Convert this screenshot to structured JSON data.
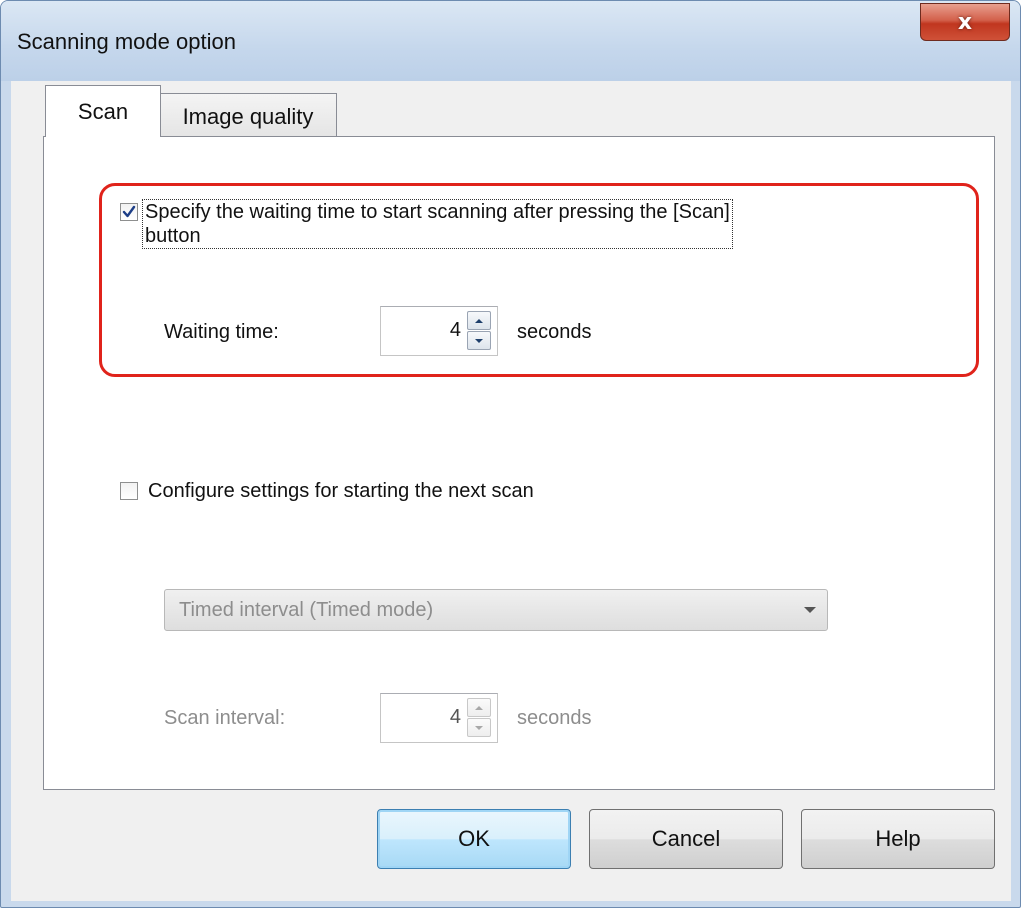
{
  "window": {
    "title": "Scanning mode option",
    "close_label": "x"
  },
  "tabs": [
    {
      "label": "Scan",
      "active": true
    },
    {
      "label": "Image quality",
      "active": false
    }
  ],
  "waiting": {
    "checkbox_checked": true,
    "checkbox_label_line1": "Specify the waiting time to start scanning after pressing the [Scan]",
    "checkbox_label_line2": "button",
    "time_label": "Waiting time:",
    "time_value": "4",
    "unit": "seconds",
    "highlight_color": "#e0231b"
  },
  "next_scan": {
    "checkbox_checked": false,
    "checkbox_label": "Configure settings for starting the next scan",
    "mode_selected": "Timed interval (Timed mode)",
    "interval_label": "Scan interval:",
    "interval_value": "4",
    "unit": "seconds",
    "disabled": true
  },
  "buttons": {
    "ok": "OK",
    "cancel": "Cancel",
    "help": "Help"
  },
  "colors": {
    "accent_blue": "#3c7fb1",
    "disabled_text": "#8d8d8d"
  }
}
